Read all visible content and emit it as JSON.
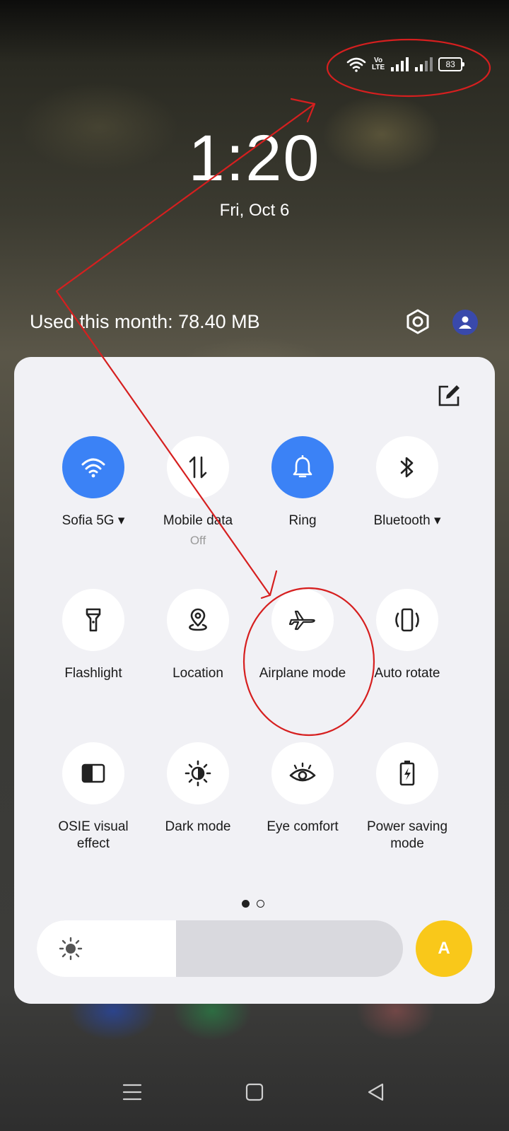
{
  "status_bar": {
    "battery_level": "83",
    "volte_line1": "Vo",
    "volte_line2": "LTE"
  },
  "lockscreen": {
    "time": "1:20",
    "date": "Fri, Oct 6"
  },
  "data_usage": {
    "text": "Used this month: 78.40 MB"
  },
  "quick_settings": {
    "tiles": [
      {
        "label": "Sofia 5G",
        "state": "on",
        "icon": "wifi-icon",
        "has_dropdown": true
      },
      {
        "label": "Mobile data",
        "sub": "Off",
        "state": "off",
        "icon": "mobile-data-icon"
      },
      {
        "label": "Ring",
        "state": "on",
        "icon": "bell-icon"
      },
      {
        "label": "Bluetooth",
        "state": "off",
        "icon": "bluetooth-icon",
        "has_dropdown": true
      },
      {
        "label": "Flashlight",
        "state": "off",
        "icon": "flashlight-icon"
      },
      {
        "label": "Location",
        "state": "off",
        "icon": "location-icon"
      },
      {
        "label": "Airplane mode",
        "state": "off",
        "icon": "airplane-icon"
      },
      {
        "label": "Auto rotate",
        "state": "off",
        "icon": "auto-rotate-icon"
      },
      {
        "label": "OSIE visual effect",
        "state": "off",
        "icon": "osie-icon"
      },
      {
        "label": "Dark mode",
        "state": "off",
        "icon": "dark-mode-icon"
      },
      {
        "label": "Eye comfort",
        "state": "off",
        "icon": "eye-icon"
      },
      {
        "label": "Power saving mode",
        "state": "off",
        "icon": "battery-saver-icon"
      }
    ],
    "page_count": 2,
    "current_page": 1,
    "brightness_level": 0.38,
    "auto_brightness_label": "A"
  },
  "colors": {
    "tile_on": "#3b82f6",
    "auto_brightness": "#f9c81a",
    "annotation": "#d61f1f"
  }
}
